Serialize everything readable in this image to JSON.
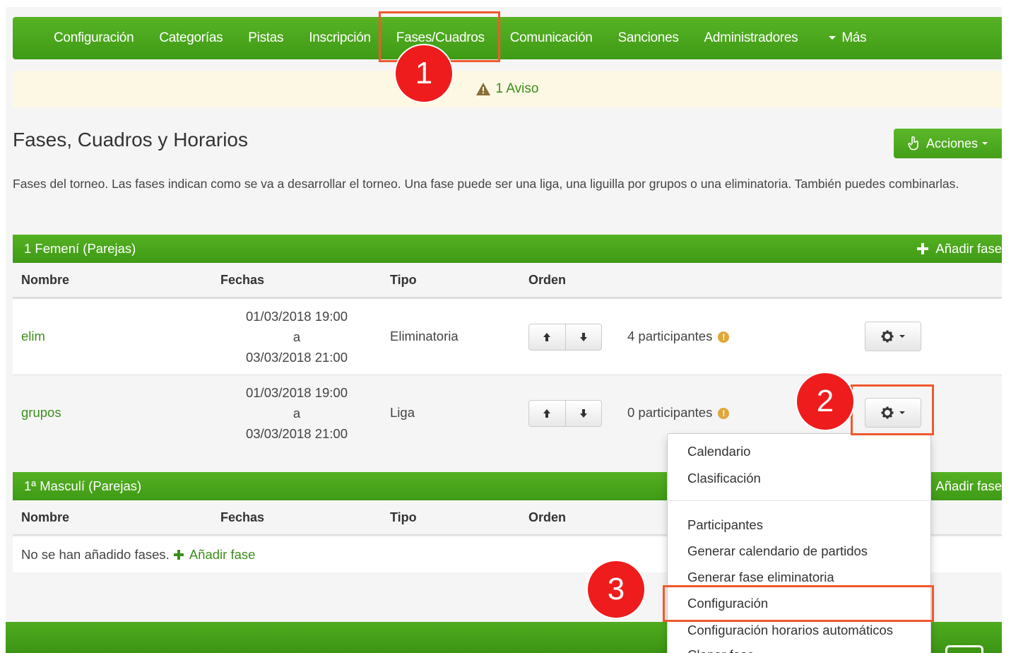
{
  "navbar": {
    "items": [
      "Configuración",
      "Categorías",
      "Pistas",
      "Inscripción",
      "Fases/Cuadros",
      "Comunicación",
      "Sanciones",
      "Administradores"
    ],
    "more_label": "Más"
  },
  "alert": {
    "icon": "warning-icon",
    "text": "1 Aviso"
  },
  "page": {
    "title": "Fases, Cuadros y Horarios",
    "actions_label": "Acciones",
    "description": "Fases del torneo. Las fases indican como se va a desarrollar el torneo. Una fase puede ser una liga, una liguilla por grupos o una eliminatoria. También puedes combinarlas."
  },
  "table_headers": {
    "name": "Nombre",
    "dates": "Fechas",
    "type": "Tipo",
    "order": "Orden"
  },
  "categories": [
    {
      "title": "1 Femení (Parejas)",
      "add_label": "Añadir fase",
      "rows": [
        {
          "name": "elim",
          "date_start": "01/03/2018 19:00",
          "date_sep": "a",
          "date_end": "03/03/2018 21:00",
          "type": "Eliminatoria",
          "participants": "4 participantes"
        },
        {
          "name": "grupos",
          "date_start": "01/03/2018 19:00",
          "date_sep": "a",
          "date_end": "03/03/2018 21:00",
          "type": "Liga",
          "participants": "0 participantes"
        }
      ]
    },
    {
      "title": "1ª Masculí (Parejas)",
      "add_label": "Añadir fase",
      "empty_text": "No se han añadido fases.",
      "empty_add_label": "Añadir fase"
    }
  ],
  "dropdown": {
    "items": [
      "Calendario",
      "Clasificación",
      "Participantes",
      "Generar calendario de partidos",
      "Generar fase eliminatoria",
      "Configuración",
      "Configuración horarios automáticos",
      "Clonar fase"
    ]
  },
  "annotations": {
    "step1": "1",
    "step2": "2",
    "step3": "3",
    "highlight_color": "#ef5a2e",
    "badge_color": "#ee1c1c"
  },
  "colors": {
    "brand_green": "#4caf1f",
    "link_green": "#3c8d1a",
    "alert_bg": "#fcf8e3"
  }
}
